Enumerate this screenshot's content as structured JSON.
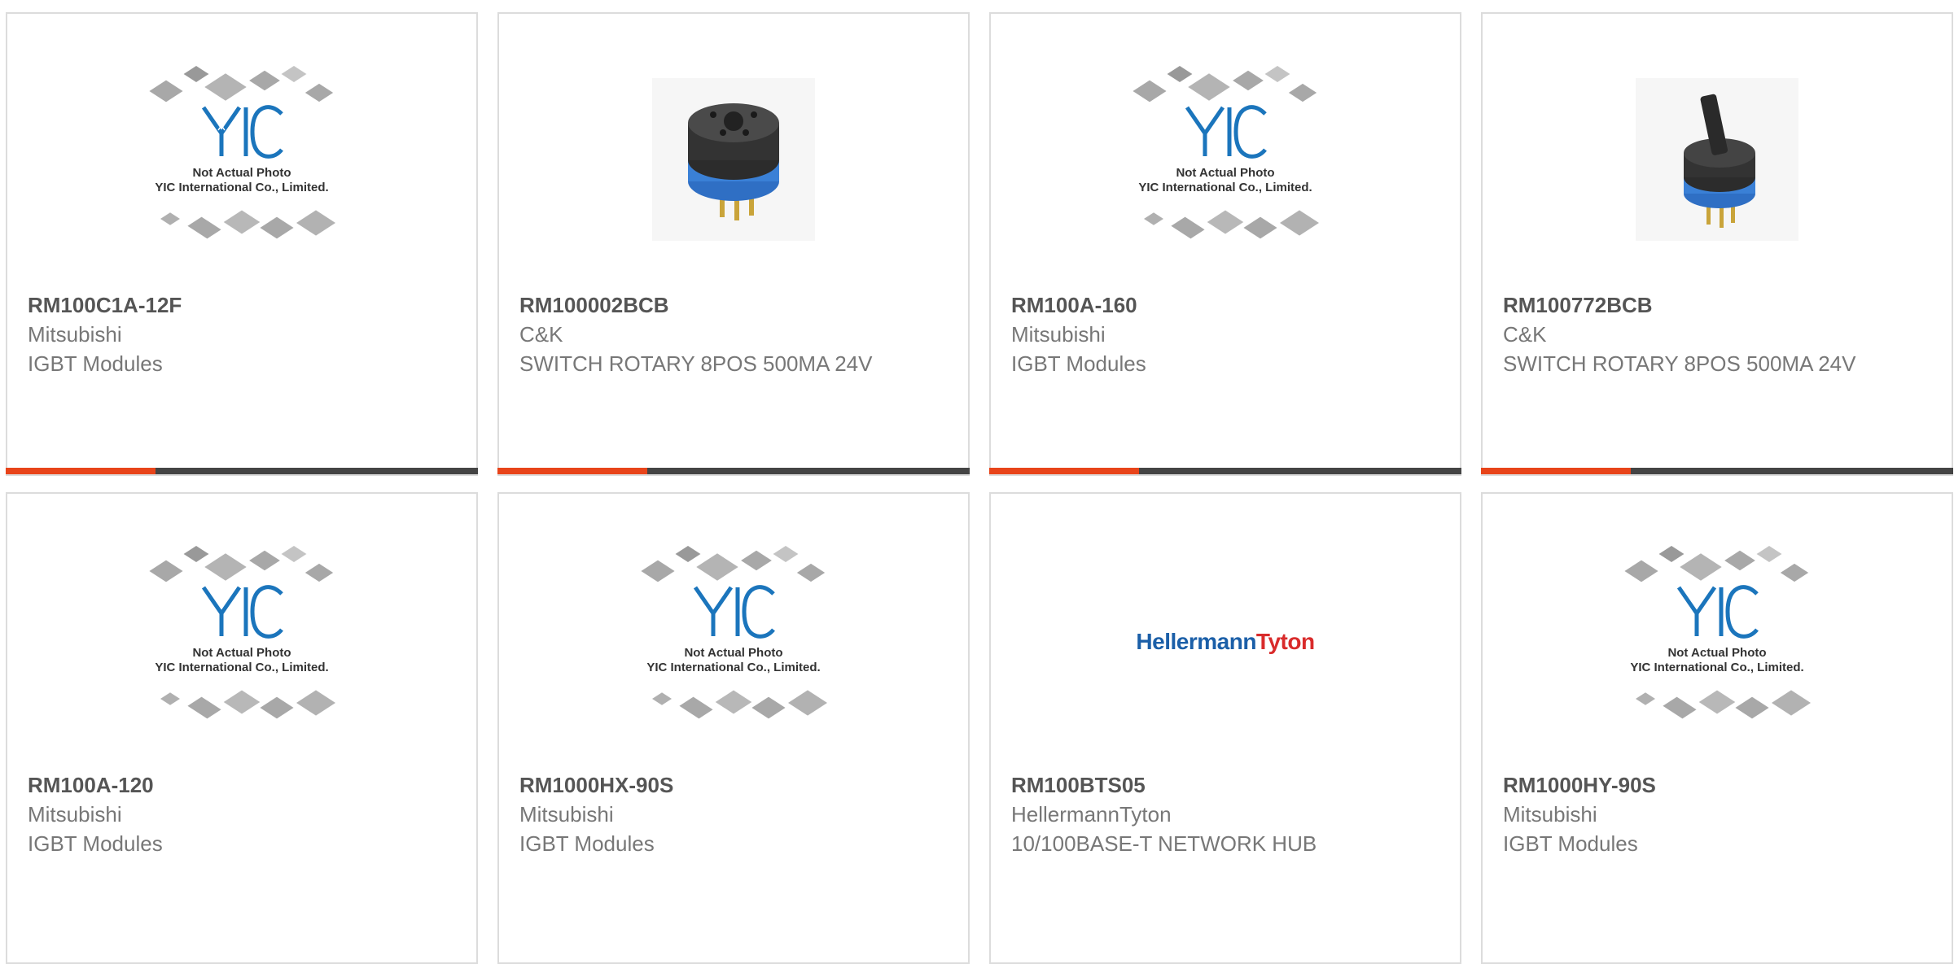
{
  "colors": {
    "accent": "#e8441a",
    "bar": "#444444",
    "border": "#dcdcdc",
    "part_number": "#555555",
    "text": "#777777",
    "logo_blue": "#1b5fa8",
    "logo_red": "#d92b2b"
  },
  "placeholder": {
    "line1": "Not Actual Photo",
    "line2": "YIC International Co., Limited."
  },
  "products": [
    {
      "part_number": "RM100C1A-12F",
      "manufacturer": "Mitsubishi",
      "description": "IGBT Modules",
      "image": "placeholder"
    },
    {
      "part_number": "RM100002BCB",
      "manufacturer": "C&K",
      "description": "SWITCH ROTARY 8POS 500MA 24V",
      "image": "rotary-switch-photo"
    },
    {
      "part_number": "RM100A-160",
      "manufacturer": "Mitsubishi",
      "description": "IGBT Modules",
      "image": "placeholder"
    },
    {
      "part_number": "RM100772BCB",
      "manufacturer": "C&K",
      "description": "SWITCH ROTARY 8POS 500MA 24V",
      "image": "rotary-switch-shaft-photo"
    },
    {
      "part_number": "RM100A-120",
      "manufacturer": "Mitsubishi",
      "description": "IGBT Modules",
      "image": "placeholder"
    },
    {
      "part_number": "RM1000HX-90S",
      "manufacturer": "Mitsubishi",
      "description": "IGBT Modules",
      "image": "placeholder"
    },
    {
      "part_number": "RM100BTS05",
      "manufacturer": "HellermannTyton",
      "description": "10/100BASE-T NETWORK HUB",
      "image": "hellermanntyton-logo",
      "logo_part1": "Hellermann",
      "logo_part2": "Tyton"
    },
    {
      "part_number": "RM1000HY-90S",
      "manufacturer": "Mitsubishi",
      "description": "IGBT Modules",
      "image": "placeholder"
    }
  ]
}
